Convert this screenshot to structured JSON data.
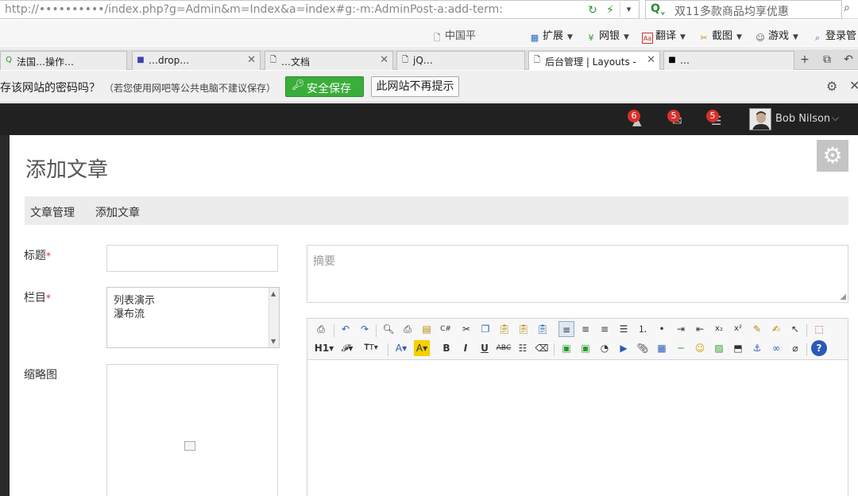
{
  "browser": {
    "url": "http://••••••••••/index.php?g=Admin&m=Index&a=index#g:-m:AdminPost-a:add-term:",
    "search_placeholder": "双11多款商品均享优惠",
    "favorites": [
      {
        "label": "扩展",
        "icon": "extension-icon"
      },
      {
        "label": "网银",
        "icon": "bank-icon"
      },
      {
        "label": "翻译",
        "icon": "translate-icon"
      },
      {
        "label": "截图",
        "icon": "screenshot-icon"
      },
      {
        "label": "游戏",
        "icon": "game-icon"
      },
      {
        "label": "登录管",
        "icon": "login-icon"
      }
    ],
    "bookmark_partial": "中国平",
    "tabs": [
      {
        "label": "法国…操作…",
        "active": false
      },
      {
        "label": "…drop…",
        "active": false
      },
      {
        "label": "…文档",
        "active": false
      },
      {
        "label": "jQ…",
        "active": false
      },
      {
        "label": "后台管理 | Layouts -",
        "active": true
      },
      {
        "label": "…",
        "active": false
      }
    ],
    "password_bar": {
      "prompt": "存该网站的密码吗？",
      "hint": "（若您使用网吧等公共电脑不建议保存）",
      "save_label": "安全保存",
      "never_label": "此网站不再提示"
    }
  },
  "topbar": {
    "notifications": [
      {
        "name": "alerts",
        "count": "6",
        "icon": "warning-icon"
      },
      {
        "name": "messages",
        "count": "5",
        "icon": "envelope-icon"
      },
      {
        "name": "tasks",
        "count": "5",
        "icon": "tasks-icon"
      }
    ],
    "user_name": "Bob Nilson"
  },
  "page": {
    "title": "添加文章",
    "breadcrumb": [
      "文章管理",
      "添加文章"
    ]
  },
  "form": {
    "title_label": "标题",
    "title_value": "",
    "category_label": "栏目",
    "category_options": [
      "列表演示",
      "瀑布流"
    ],
    "thumbnail_label": "缩略图",
    "summary_placeholder": "摘要",
    "required_mark": "*"
  },
  "editor": {
    "toolbar_row1": [
      "source",
      "undo",
      "redo",
      "preview",
      "print",
      "template",
      "code",
      "cut",
      "copy",
      "paste",
      "paste-plain",
      "paste-word",
      "align-left",
      "align-center",
      "align-right",
      "justify",
      "ordered-list",
      "unordered-list",
      "indent",
      "outdent",
      "subscript",
      "superscript",
      "clear-format",
      "select-all",
      "cursor",
      "fullscreen"
    ],
    "toolbar_row2": [
      "H1",
      "font-family",
      "font-size",
      "font-color",
      "highlight",
      "bold",
      "italic",
      "underline",
      "strikethrough",
      "line-height",
      "remove-format",
      "image",
      "multi-image",
      "flash",
      "media",
      "insert-file",
      "table",
      "hr",
      "emoticon",
      "link-image",
      "pagebreak",
      "anchor",
      "link",
      "unlink",
      "about"
    ]
  },
  "colors": {
    "topbar_bg": "#212121",
    "badge": "#d9312b",
    "save_green": "#3aad3a",
    "breadcrumb_bg": "#ececec"
  }
}
